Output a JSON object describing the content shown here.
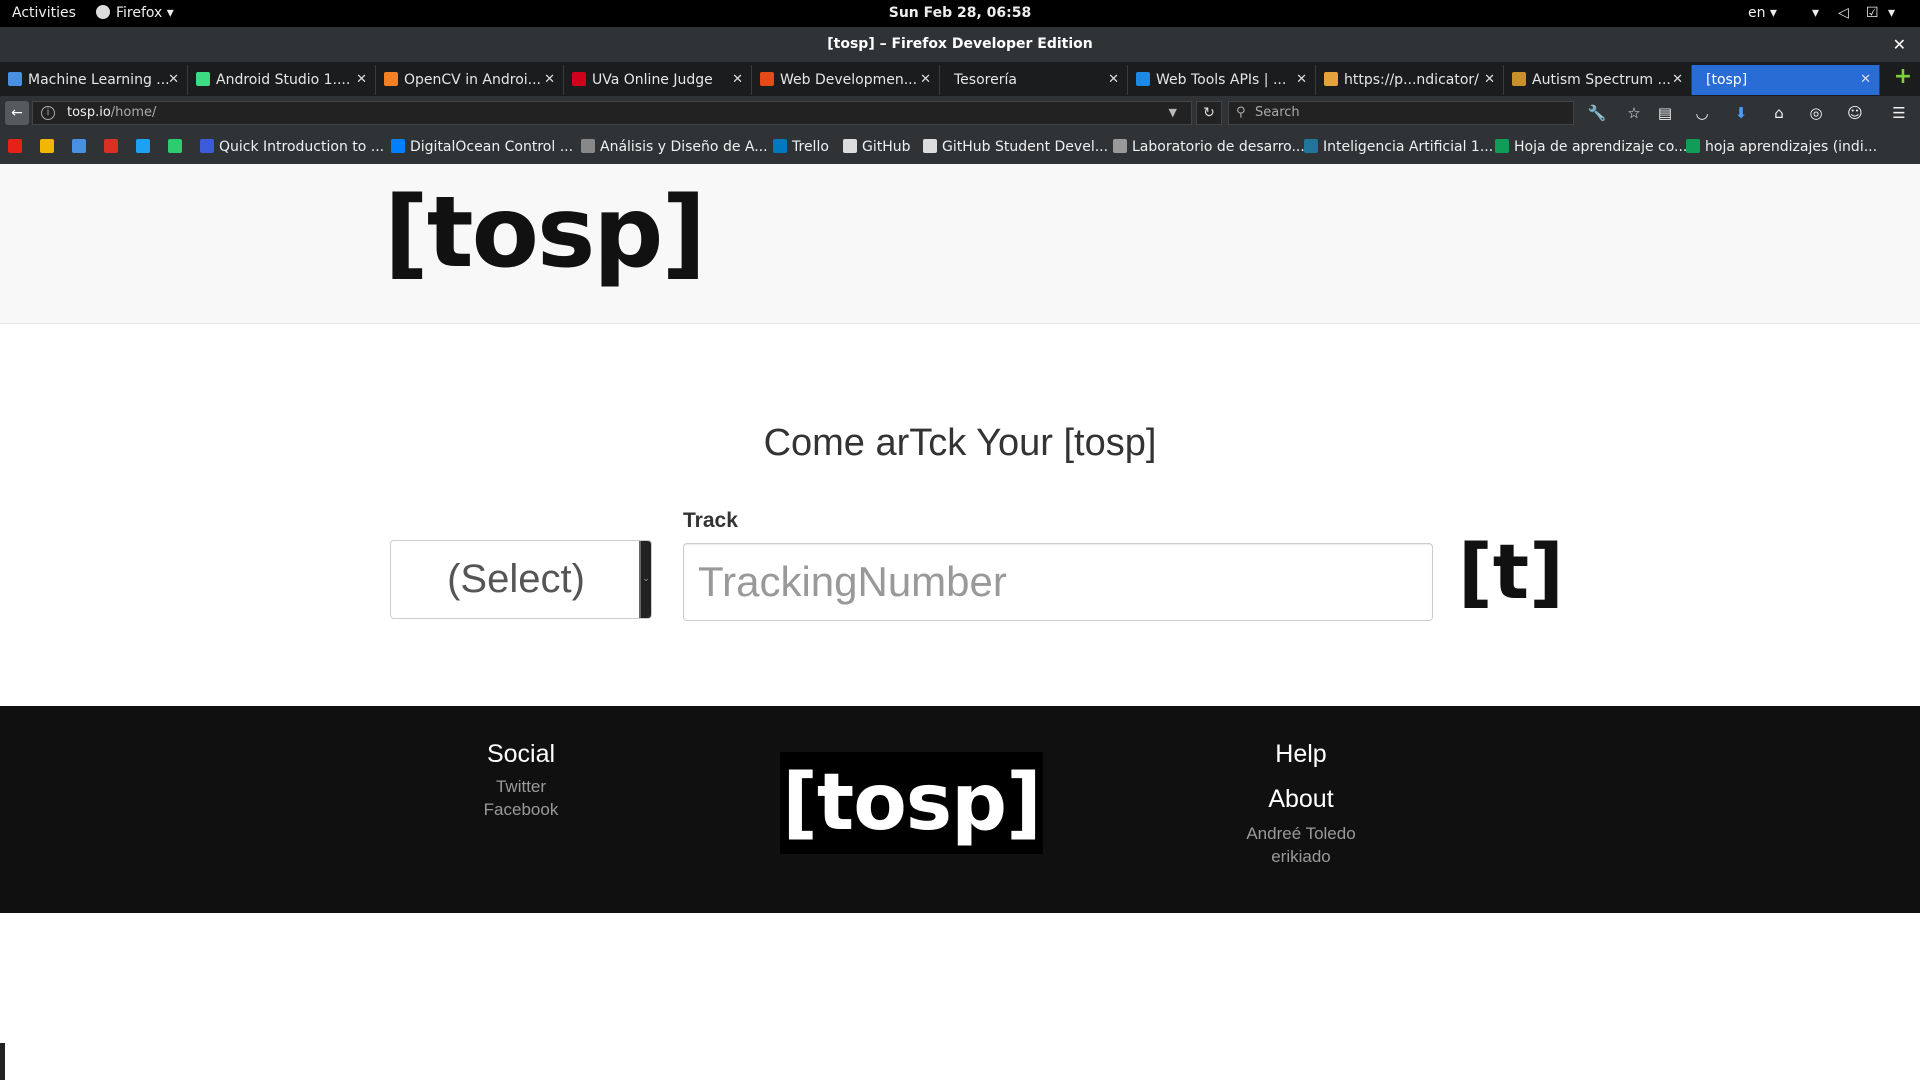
{
  "topbar": {
    "activities": "Activities",
    "app_menu": "Firefox ▾",
    "clock": "Sun Feb 28, 06:58",
    "language": "en ▾"
  },
  "window": {
    "title": "[tosp] – Firefox Developer Edition"
  },
  "tabs": [
    {
      "label": "Machine Learning ...",
      "icon_color": "#4a90e2"
    },
    {
      "label": "Android Studio 1....",
      "icon_color": "#3ddc84"
    },
    {
      "label": "OpenCV in Androi...",
      "icon_color": "#f48024"
    },
    {
      "label": "UVa Online Judge",
      "icon_color": "#d0021b"
    },
    {
      "label": "Web Developmen...",
      "icon_color": "#e64a19"
    },
    {
      "label": "Tesorería",
      "icon_color": ""
    },
    {
      "label": "Web Tools APIs | ...",
      "icon_color": "#1e88e5"
    },
    {
      "label": "https://p...ndicator/",
      "icon_color": "#e3a33a"
    },
    {
      "label": "Autism Spectrum ...",
      "icon_color": "#c8902a"
    },
    {
      "label": "[tosp]",
      "icon_color": "",
      "active": true
    }
  ],
  "navbar": {
    "url_host": "tosp.io",
    "url_path": "/home/",
    "search_placeholder": "Search"
  },
  "bookmarks": [
    {
      "label": "",
      "icon_color": "#e62117"
    },
    {
      "label": "",
      "icon_color": "#f2b705"
    },
    {
      "label": "",
      "icon_color": "#4a90e2"
    },
    {
      "label": "",
      "icon_color": "#d93025"
    },
    {
      "label": "",
      "icon_color": "#1da1f2"
    },
    {
      "label": "",
      "icon_color": "#2ecc71"
    },
    {
      "label": "Quick Introduction to ...",
      "icon_color": "#3b5bdb"
    },
    {
      "label": "DigitalOcean Control ...",
      "icon_color": "#0080ff"
    },
    {
      "label": "Análisis y Diseño de A...",
      "icon_color": "#888888"
    },
    {
      "label": "Trello",
      "icon_color": "#0079bf"
    },
    {
      "label": "GitHub",
      "icon_color": "#dddddd"
    },
    {
      "label": "GitHub Student Devel...",
      "icon_color": "#dddddd"
    },
    {
      "label": "Laboratorio de desarro...",
      "icon_color": "#999999"
    },
    {
      "label": "Inteligencia Artificial 1...",
      "icon_color": "#21759b"
    },
    {
      "label": "Hoja de aprendizaje co...",
      "icon_color": "#0f9d58"
    },
    {
      "label": "hoja aprendizajes (indi...",
      "icon_color": "#0f9d58"
    }
  ],
  "site": {
    "logo": "[tosp]",
    "hero_title": "Come arTck Your [tosp]",
    "track_label": "Track",
    "carrier_select_value": "(Select)",
    "tracking_placeholder": "TrackingNumber",
    "track_button": "[t]"
  },
  "footer": {
    "social_heading": "Social",
    "social_links": [
      "Twitter",
      "Facebook"
    ],
    "logo": "[tosp]",
    "help_heading": "Help",
    "about_heading": "About",
    "about_names": [
      "Andreé Toledo",
      "erikiado"
    ]
  }
}
